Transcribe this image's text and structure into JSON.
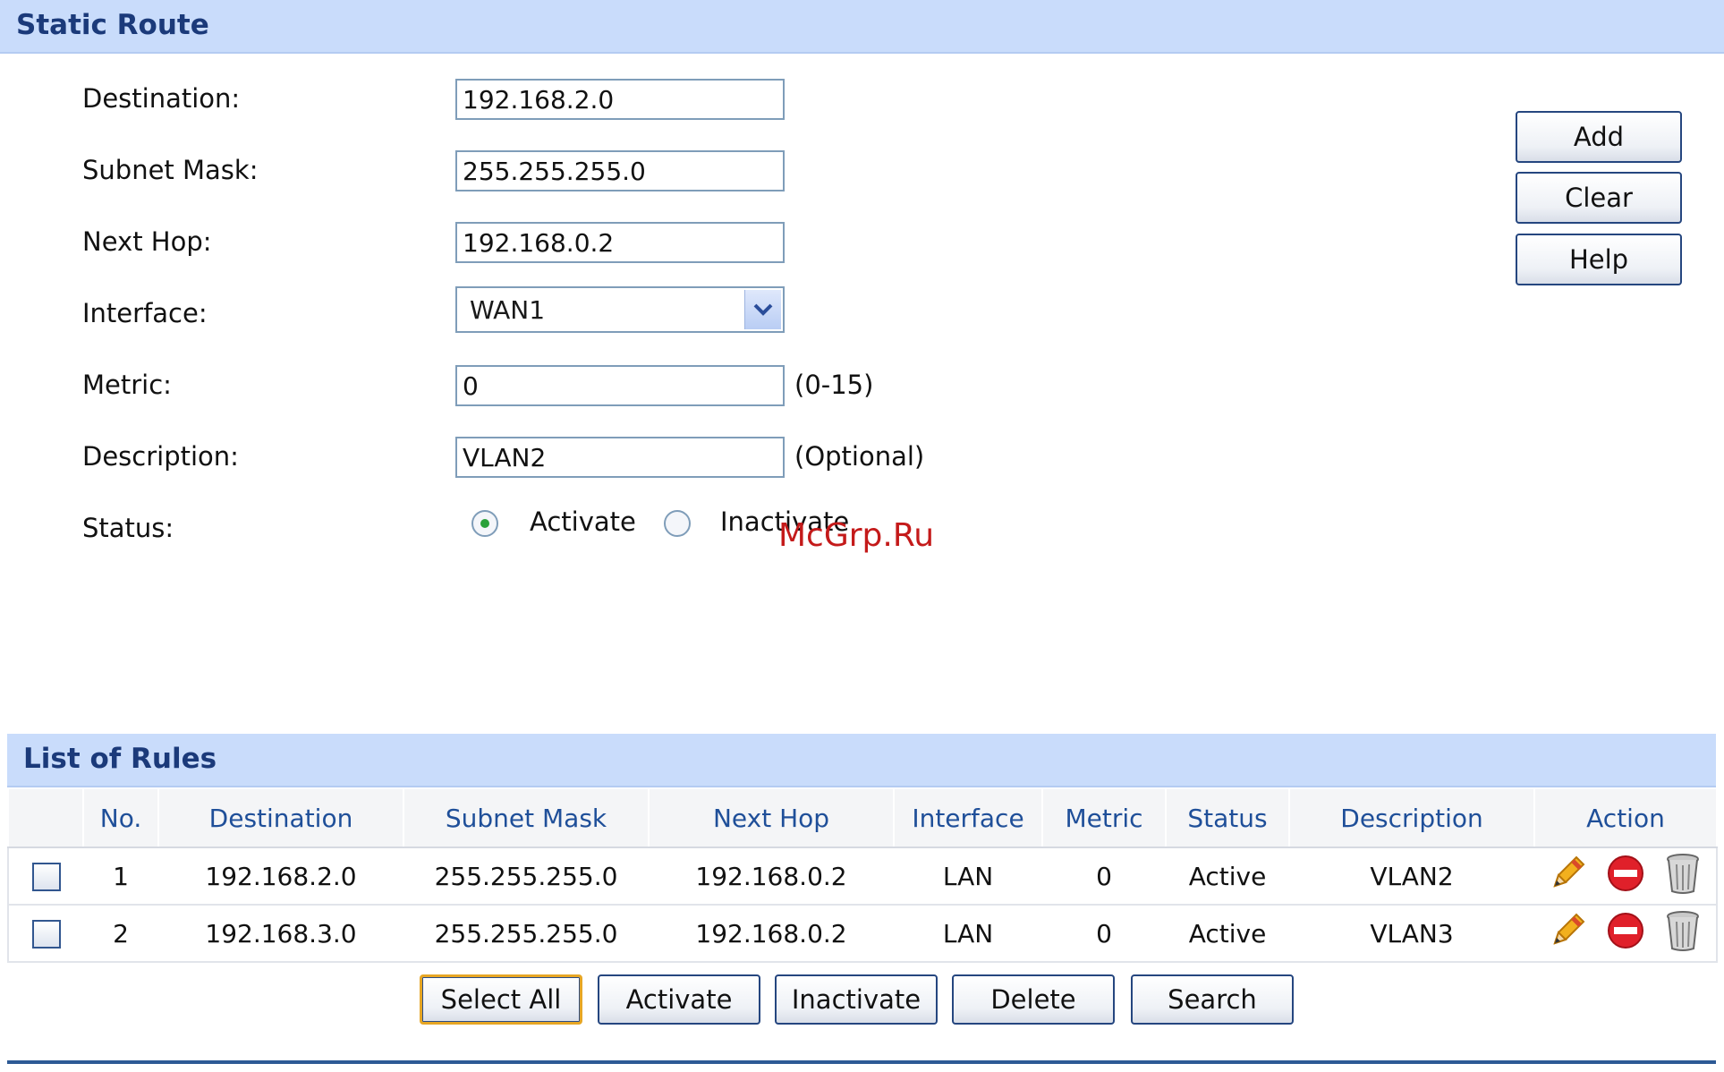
{
  "static_route": {
    "title": "Static Route",
    "fields": {
      "destination": {
        "label": "Destination:",
        "value": "192.168.2.0"
      },
      "subnet_mask": {
        "label": "Subnet Mask:",
        "value": "255.255.255.0"
      },
      "next_hop": {
        "label": "Next Hop:",
        "value": "192.168.0.2"
      },
      "interface": {
        "label": "Interface:",
        "value": "WAN1"
      },
      "metric": {
        "label": "Metric:",
        "value": "0",
        "hint": "(0-15)"
      },
      "description": {
        "label": "Description:",
        "value": "VLAN2",
        "hint": "(Optional)"
      },
      "status": {
        "label": "Status:",
        "options": [
          "Activate",
          "Inactivate"
        ],
        "selected": "Activate"
      }
    },
    "buttons": {
      "add": "Add",
      "clear": "Clear",
      "help": "Help"
    }
  },
  "watermark": "McGrp.Ru",
  "rules": {
    "title": "List of Rules",
    "columns": [
      "No.",
      "Destination",
      "Subnet Mask",
      "Next Hop",
      "Interface",
      "Metric",
      "Status",
      "Description",
      "Action"
    ],
    "rows": [
      {
        "no": "1",
        "destination": "192.168.2.0",
        "subnet_mask": "255.255.255.0",
        "next_hop": "192.168.0.2",
        "interface": "LAN",
        "metric": "0",
        "status": "Active",
        "description": "VLAN2"
      },
      {
        "no": "2",
        "destination": "192.168.3.0",
        "subnet_mask": "255.255.255.0",
        "next_hop": "192.168.0.2",
        "interface": "LAN",
        "metric": "0",
        "status": "Active",
        "description": "VLAN3"
      }
    ],
    "action_icons": [
      "pencil-edit-icon",
      "disable-icon",
      "trash-icon"
    ],
    "buttons": {
      "select_all": "Select All",
      "activate": "Activate",
      "inactivate": "Inactivate",
      "delete": "Delete",
      "search": "Search"
    }
  },
  "colors": {
    "header_bg": "#c9dcfb",
    "header_text": "#1b3a7a",
    "column_text": "#1f4f99",
    "watermark": "#c41a1a"
  }
}
